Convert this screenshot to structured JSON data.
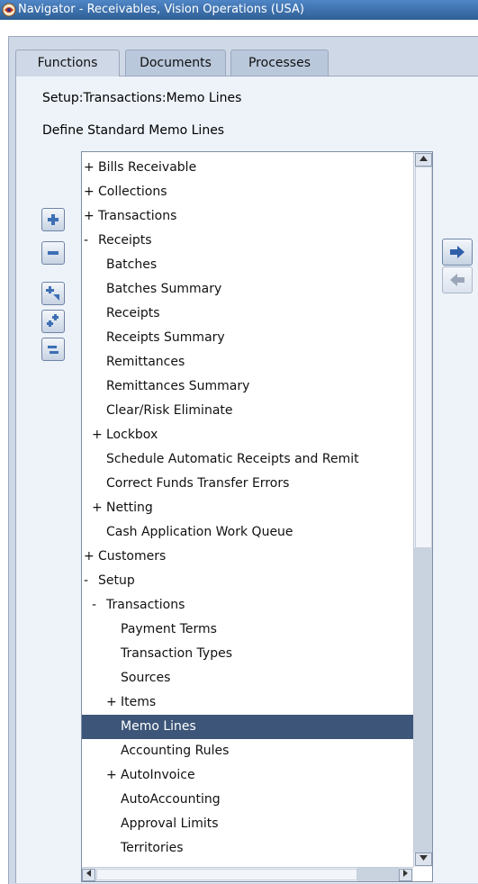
{
  "window": {
    "title": "Navigator - Receivables, Vision Operations (USA)",
    "icon": "oracle-swirl-icon"
  },
  "tabs": [
    {
      "label": "Functions",
      "active": true
    },
    {
      "label": "Documents",
      "active": false
    },
    {
      "label": "Processes",
      "active": false
    }
  ],
  "path": "Setup:Transactions:Memo Lines",
  "description": "Define Standard Memo Lines",
  "tree": {
    "rows": [
      {
        "prefix": "+",
        "label": "Bills Receivable",
        "level": 0
      },
      {
        "prefix": "+",
        "label": "Collections",
        "level": 0
      },
      {
        "prefix": "+",
        "label": "Transactions",
        "level": 0
      },
      {
        "prefix": "-",
        "label": "Receipts",
        "level": 0
      },
      {
        "prefix": "",
        "label": "Batches",
        "level": 1
      },
      {
        "prefix": "",
        "label": "Batches Summary",
        "level": 1
      },
      {
        "prefix": "",
        "label": "Receipts",
        "level": 1
      },
      {
        "prefix": "",
        "label": "Receipts Summary",
        "level": 1
      },
      {
        "prefix": "",
        "label": "Remittances",
        "level": 1
      },
      {
        "prefix": "",
        "label": "Remittances Summary",
        "level": 1
      },
      {
        "prefix": "",
        "label": "Clear/Risk Eliminate",
        "level": 1
      },
      {
        "prefix": "+",
        "label": "Lockbox",
        "level": 1
      },
      {
        "prefix": "",
        "label": "Schedule Automatic Receipts and Remit",
        "level": 1
      },
      {
        "prefix": "",
        "label": "Correct Funds Transfer Errors",
        "level": 1
      },
      {
        "prefix": "+",
        "label": "Netting",
        "level": 1
      },
      {
        "prefix": "",
        "label": "Cash Application Work Queue",
        "level": 1
      },
      {
        "prefix": "+",
        "label": "Customers",
        "level": 0
      },
      {
        "prefix": "-",
        "label": "Setup",
        "level": 0
      },
      {
        "prefix": "-",
        "label": "Transactions",
        "level": 1
      },
      {
        "prefix": "",
        "label": "Payment Terms",
        "level": 2
      },
      {
        "prefix": "",
        "label": "Transaction Types",
        "level": 2
      },
      {
        "prefix": "",
        "label": "Sources",
        "level": 2
      },
      {
        "prefix": "+",
        "label": "Items",
        "level": 2
      },
      {
        "prefix": "",
        "label": "Memo Lines",
        "level": 2,
        "selected": true
      },
      {
        "prefix": "",
        "label": "Accounting Rules",
        "level": 2
      },
      {
        "prefix": "+",
        "label": "AutoInvoice",
        "level": 2
      },
      {
        "prefix": "",
        "label": "AutoAccounting",
        "level": 2
      },
      {
        "prefix": "",
        "label": "Approval Limits",
        "level": 2
      },
      {
        "prefix": "",
        "label": "Territories",
        "level": 2
      }
    ]
  },
  "toolbar": [
    {
      "name": "expand-button",
      "icon": "plus-icon"
    },
    {
      "name": "collapse-button",
      "icon": "minus-icon"
    },
    {
      "name": "expand-branch-button",
      "icon": "expand-branch-icon"
    },
    {
      "name": "expand-all-button",
      "icon": "expand-all-icon"
    },
    {
      "name": "collapse-all-button",
      "icon": "collapse-all-icon"
    }
  ],
  "arrows": [
    {
      "name": "add-to-top-ten-button",
      "icon": "arrow-right-icon",
      "enabled": true
    },
    {
      "name": "remove-from-top-ten-button",
      "icon": "arrow-left-icon",
      "enabled": false
    }
  ]
}
